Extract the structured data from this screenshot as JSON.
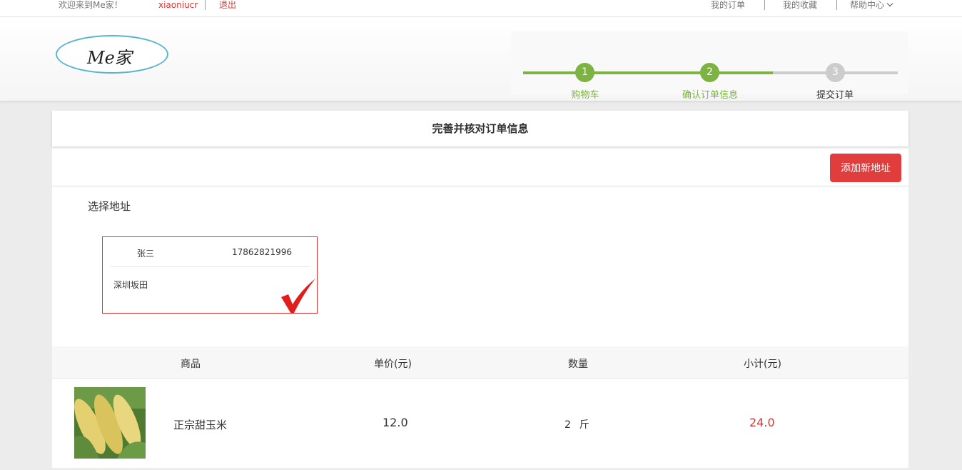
{
  "topbar": {
    "welcome": "欢迎来到Me家！",
    "username": "xiaoniucr",
    "logout": "退出",
    "my_orders": "我的订单",
    "my_favorites": "我的收藏",
    "help_center": "帮助中心"
  },
  "header": {
    "logo_text": "Me家",
    "steps": [
      {
        "number": "1",
        "label": "购物车",
        "state": "done"
      },
      {
        "number": "2",
        "label": "确认订单信息",
        "state": "current"
      },
      {
        "number": "3",
        "label": "提交订单",
        "state": "todo"
      }
    ]
  },
  "main": {
    "title": "完善并核对订单信息",
    "add_address_button": "添加新地址",
    "select_address_label": "选择地址",
    "address": {
      "name": "张三",
      "phone": "17862821996",
      "detail": "深圳坂田",
      "selected": true
    },
    "table": {
      "headers": [
        "商品",
        "单价(元)",
        "数量",
        "小计(元)"
      ],
      "rows": [
        {
          "name": "正宗甜玉米",
          "price": "12.0",
          "quantity": "2",
          "unit": "斤",
          "subtotal": "24.0",
          "image_icon": "corn-image"
        }
      ]
    }
  },
  "colors": {
    "accent_green": "#7cb342",
    "accent_red": "#e13d3d",
    "step_inactive": "#cccccc",
    "logo_border": "#5ab4cf"
  }
}
